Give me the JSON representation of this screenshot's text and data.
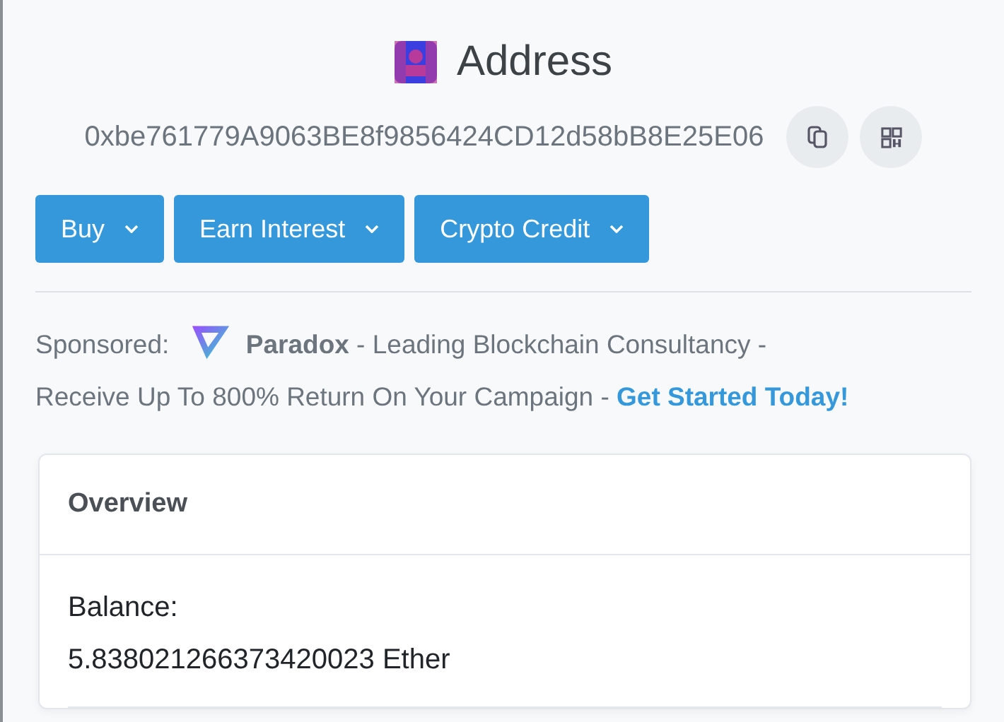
{
  "header": {
    "title": "Address"
  },
  "address": {
    "value": "0xbe761779A9063BE8f9856424CD12d58bB8E25E06"
  },
  "buttons": [
    {
      "label": "Buy"
    },
    {
      "label": "Earn Interest"
    },
    {
      "label": "Crypto Credit"
    }
  ],
  "sponsored": {
    "label": "Sponsored:",
    "text": "**Paradox** - Leading Blockchain Consultancy -",
    "text_continued": "Receive Up To 800% Return On Your Campaign - ",
    "link": "Get Started Today!"
  },
  "overview": {
    "title": "Overview",
    "balance_label": "Balance:",
    "balance_value": "5.838021266373420023 Ether"
  }
}
